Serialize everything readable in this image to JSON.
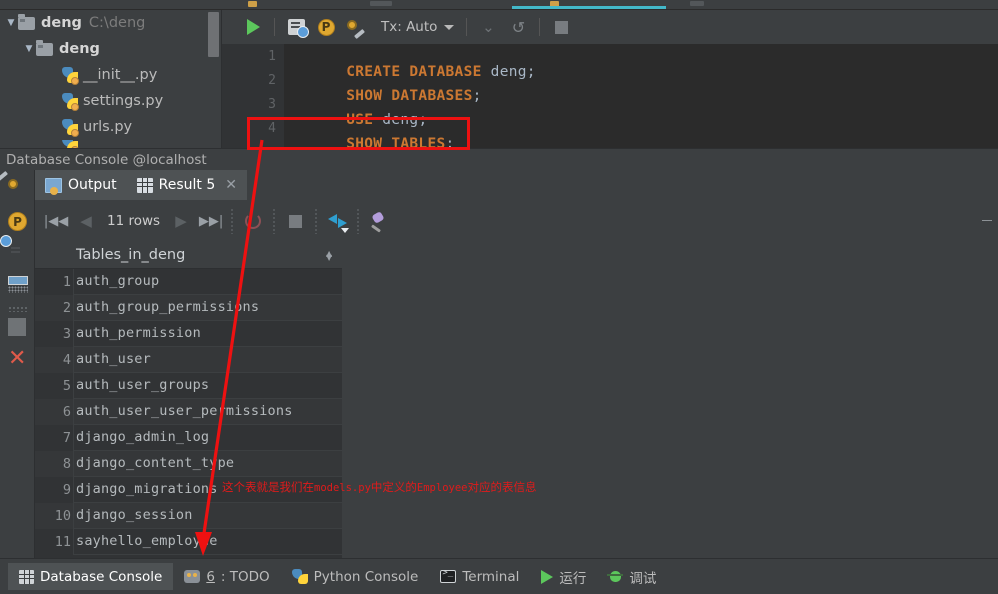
{
  "project_tree": {
    "items": [
      {
        "label": "deng",
        "path": "C:\\deng",
        "icon": "folder-icon",
        "expanded": true,
        "level": 1
      },
      {
        "label": "deng",
        "path": "",
        "icon": "folder-icon",
        "expanded": true,
        "level": 2
      },
      {
        "label": "__init__.py",
        "path": "",
        "icon": "python-file-icon",
        "level": 3
      },
      {
        "label": "settings.py",
        "path": "",
        "icon": "python-file-icon",
        "level": 3
      },
      {
        "label": "urls.py",
        "path": "",
        "icon": "python-file-icon",
        "level": 3
      }
    ]
  },
  "editor_toolbar": {
    "run_icon": "run-play-icon",
    "execute_script_icon": "execute-script-icon",
    "datasource_icon": "python-datasource-icon",
    "settings_icon": "wrench-settings-icon",
    "tx_label": "Tx: Auto",
    "tx_caret_icon": "chevron-down-icon",
    "commit_icon": "chevron-commit-icon",
    "rollback_icon": "rollback-icon",
    "stop_icon": "stop-icon"
  },
  "editor": {
    "lines": [
      {
        "num": "1",
        "keyword": "CREATE DATABASE",
        "ident": " deng",
        "punct": ";"
      },
      {
        "num": "2",
        "keyword": "SHOW DATABASES",
        "ident": "",
        "punct": ";"
      },
      {
        "num": "3",
        "keyword": "USE",
        "ident": " deng",
        "punct": ";"
      },
      {
        "num": "4",
        "keyword": "SHOW TABLES",
        "ident": "",
        "punct": ";"
      }
    ]
  },
  "console_title": "Database Console @localhost",
  "rail": {
    "icons": [
      "database-settings-icon",
      "python-circle-icon",
      "execute-script-icon",
      "table-layout-icon",
      "stop-icon",
      "close-x-icon"
    ]
  },
  "result_tabs": [
    {
      "label": "Output",
      "icon": "output-icon",
      "active": false,
      "closable": false
    },
    {
      "label": "Result 5",
      "icon": "result-grid-icon",
      "active": true,
      "closable": true
    }
  ],
  "result_toolbar": {
    "first_page_icon": "first-page-icon",
    "prev_page_icon": "prev-page-icon",
    "rows_label": "11 rows",
    "next_page_icon": "next-page-icon",
    "last_page_icon": "last-page-icon",
    "reload_icon": "reload-icon",
    "cancel_icon": "stop-icon",
    "transpose_icon": "transpose-icon",
    "pin_icon": "pin-tab-icon"
  },
  "result_grid": {
    "column_header": "Tables_in_deng",
    "sort_icon": "sort-toggle-icon",
    "rows": [
      {
        "n": "1",
        "value": "auth_group"
      },
      {
        "n": "2",
        "value": "auth_group_permissions"
      },
      {
        "n": "3",
        "value": "auth_permission"
      },
      {
        "n": "4",
        "value": "auth_user"
      },
      {
        "n": "5",
        "value": "auth_user_groups"
      },
      {
        "n": "6",
        "value": "auth_user_user_permissions"
      },
      {
        "n": "7",
        "value": "django_admin_log"
      },
      {
        "n": "8",
        "value": "django_content_type"
      },
      {
        "n": "9",
        "value": "django_migrations"
      },
      {
        "n": "10",
        "value": "django_session"
      },
      {
        "n": "11",
        "value": "sayhello_employee"
      }
    ]
  },
  "annotation": {
    "box_target": "SHOW TABLES",
    "text_prefix": "这个表就是我们在",
    "text_code1": "models.py",
    "text_middle": "中定义的",
    "text_code2": "Employee",
    "text_suffix": "对应的表信息",
    "color": "#e01b1b"
  },
  "status_bar": {
    "items": [
      {
        "label": "Database Console",
        "icon": "database-icon",
        "active": true,
        "num": ""
      },
      {
        "label": ": TODO",
        "icon": "todo-icon",
        "active": false,
        "num": "6"
      },
      {
        "label": "Python Console",
        "icon": "python-console-icon",
        "active": false,
        "num": ""
      },
      {
        "label": "Terminal",
        "icon": "terminal-icon",
        "active": false,
        "num": ""
      },
      {
        "label": "运行",
        "icon": "run-icon",
        "active": false,
        "num": ""
      },
      {
        "label": "调试",
        "icon": "debug-icon",
        "active": false,
        "num": ""
      }
    ]
  }
}
